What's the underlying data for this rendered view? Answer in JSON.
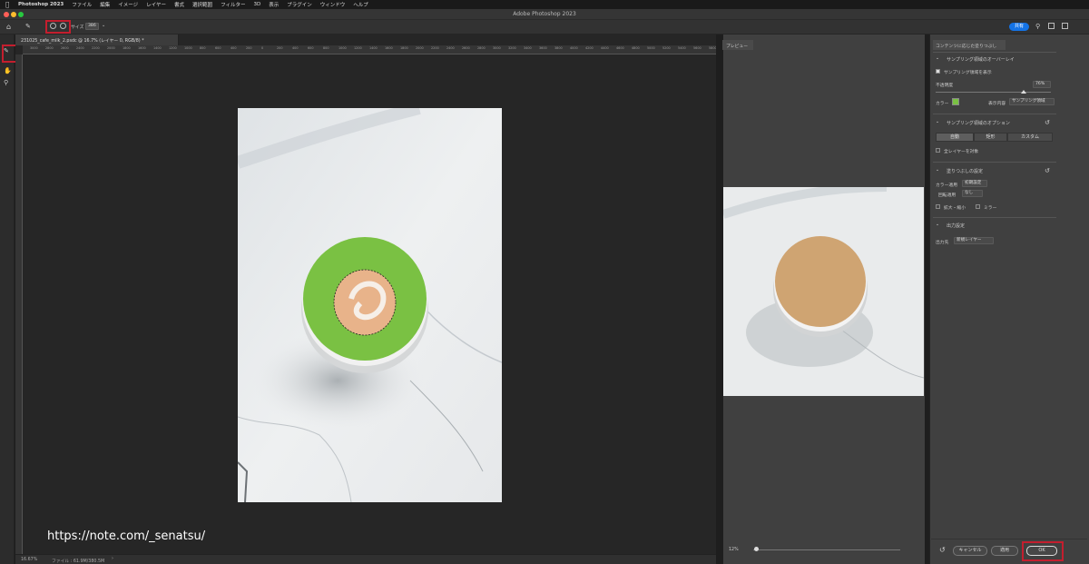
{
  "menubar": {
    "app": "Photoshop 2023",
    "items": [
      "ファイル",
      "編集",
      "イメージ",
      "レイヤー",
      "書式",
      "選択範囲",
      "フィルター",
      "3D",
      "表示",
      "プラグイン",
      "ウィンドウ",
      "ヘルプ"
    ]
  },
  "window_title": "Adobe Photoshop 2023",
  "options": {
    "size_label": "サイズ",
    "size_value": "386",
    "share_label": "共有"
  },
  "document": {
    "tab_title": "231025_cafe_milk_2.psdc @ 16.7% (レイヤー 0, RGB/8) *",
    "ruler_ticks": [
      "3000",
      "2800",
      "2600",
      "2400",
      "2200",
      "2000",
      "1800",
      "1600",
      "1400",
      "1200",
      "1000",
      "800",
      "600",
      "400",
      "200",
      "0",
      "200",
      "400",
      "600",
      "800",
      "1000",
      "1200",
      "1400",
      "1600",
      "1800",
      "2000",
      "2200",
      "2400",
      "2600",
      "2800",
      "3000",
      "3200",
      "3400",
      "3600",
      "3800",
      "4000",
      "4200",
      "4400",
      "4600",
      "4800",
      "5000",
      "5200",
      "5400",
      "5600",
      "5800"
    ],
    "zoom": "16.67%",
    "status": "ファイル : 61.9M/380.5M",
    "watermark": "https://note.com/_senatsu/"
  },
  "preview": {
    "tab": "プレビュー",
    "zoom": "12%"
  },
  "panel": {
    "header": "コンテンツに応じた塗りつぶし",
    "overlay": {
      "title": "サンプリング領域のオーバーレイ",
      "show_label": "サンプリング領域を表示",
      "opacity_label": "不透明度",
      "opacity_value": "76%",
      "opacity_fraction": 0.76,
      "color_label": "カラー",
      "color": "#7ac143",
      "indicates_label": "表示内容",
      "indicates_value": "サンプリング領域"
    },
    "sampling": {
      "title": "サンプリング領域のオプション",
      "modes": [
        "自動",
        "矩形",
        "カスタム"
      ],
      "all_layers_label": "全レイヤーを対象"
    },
    "fill": {
      "title": "塗りつぶしの設定",
      "color_adapt_label": "カラー適用",
      "color_adapt_value": "初期設定",
      "rotation_label": "回転適用",
      "rotation_value": "なし",
      "scale_label": "拡大・縮小",
      "mirror_label": "ミラー"
    },
    "output": {
      "title": "出力設定",
      "label": "出力先",
      "value": "新規レイヤー"
    },
    "buttons": {
      "cancel": "キャンセル",
      "apply": "適用",
      "ok": "OK"
    }
  },
  "colors": {
    "accent": "#1473e6",
    "highlight": "#c41e2e",
    "overlay_green": "#7ac143"
  }
}
